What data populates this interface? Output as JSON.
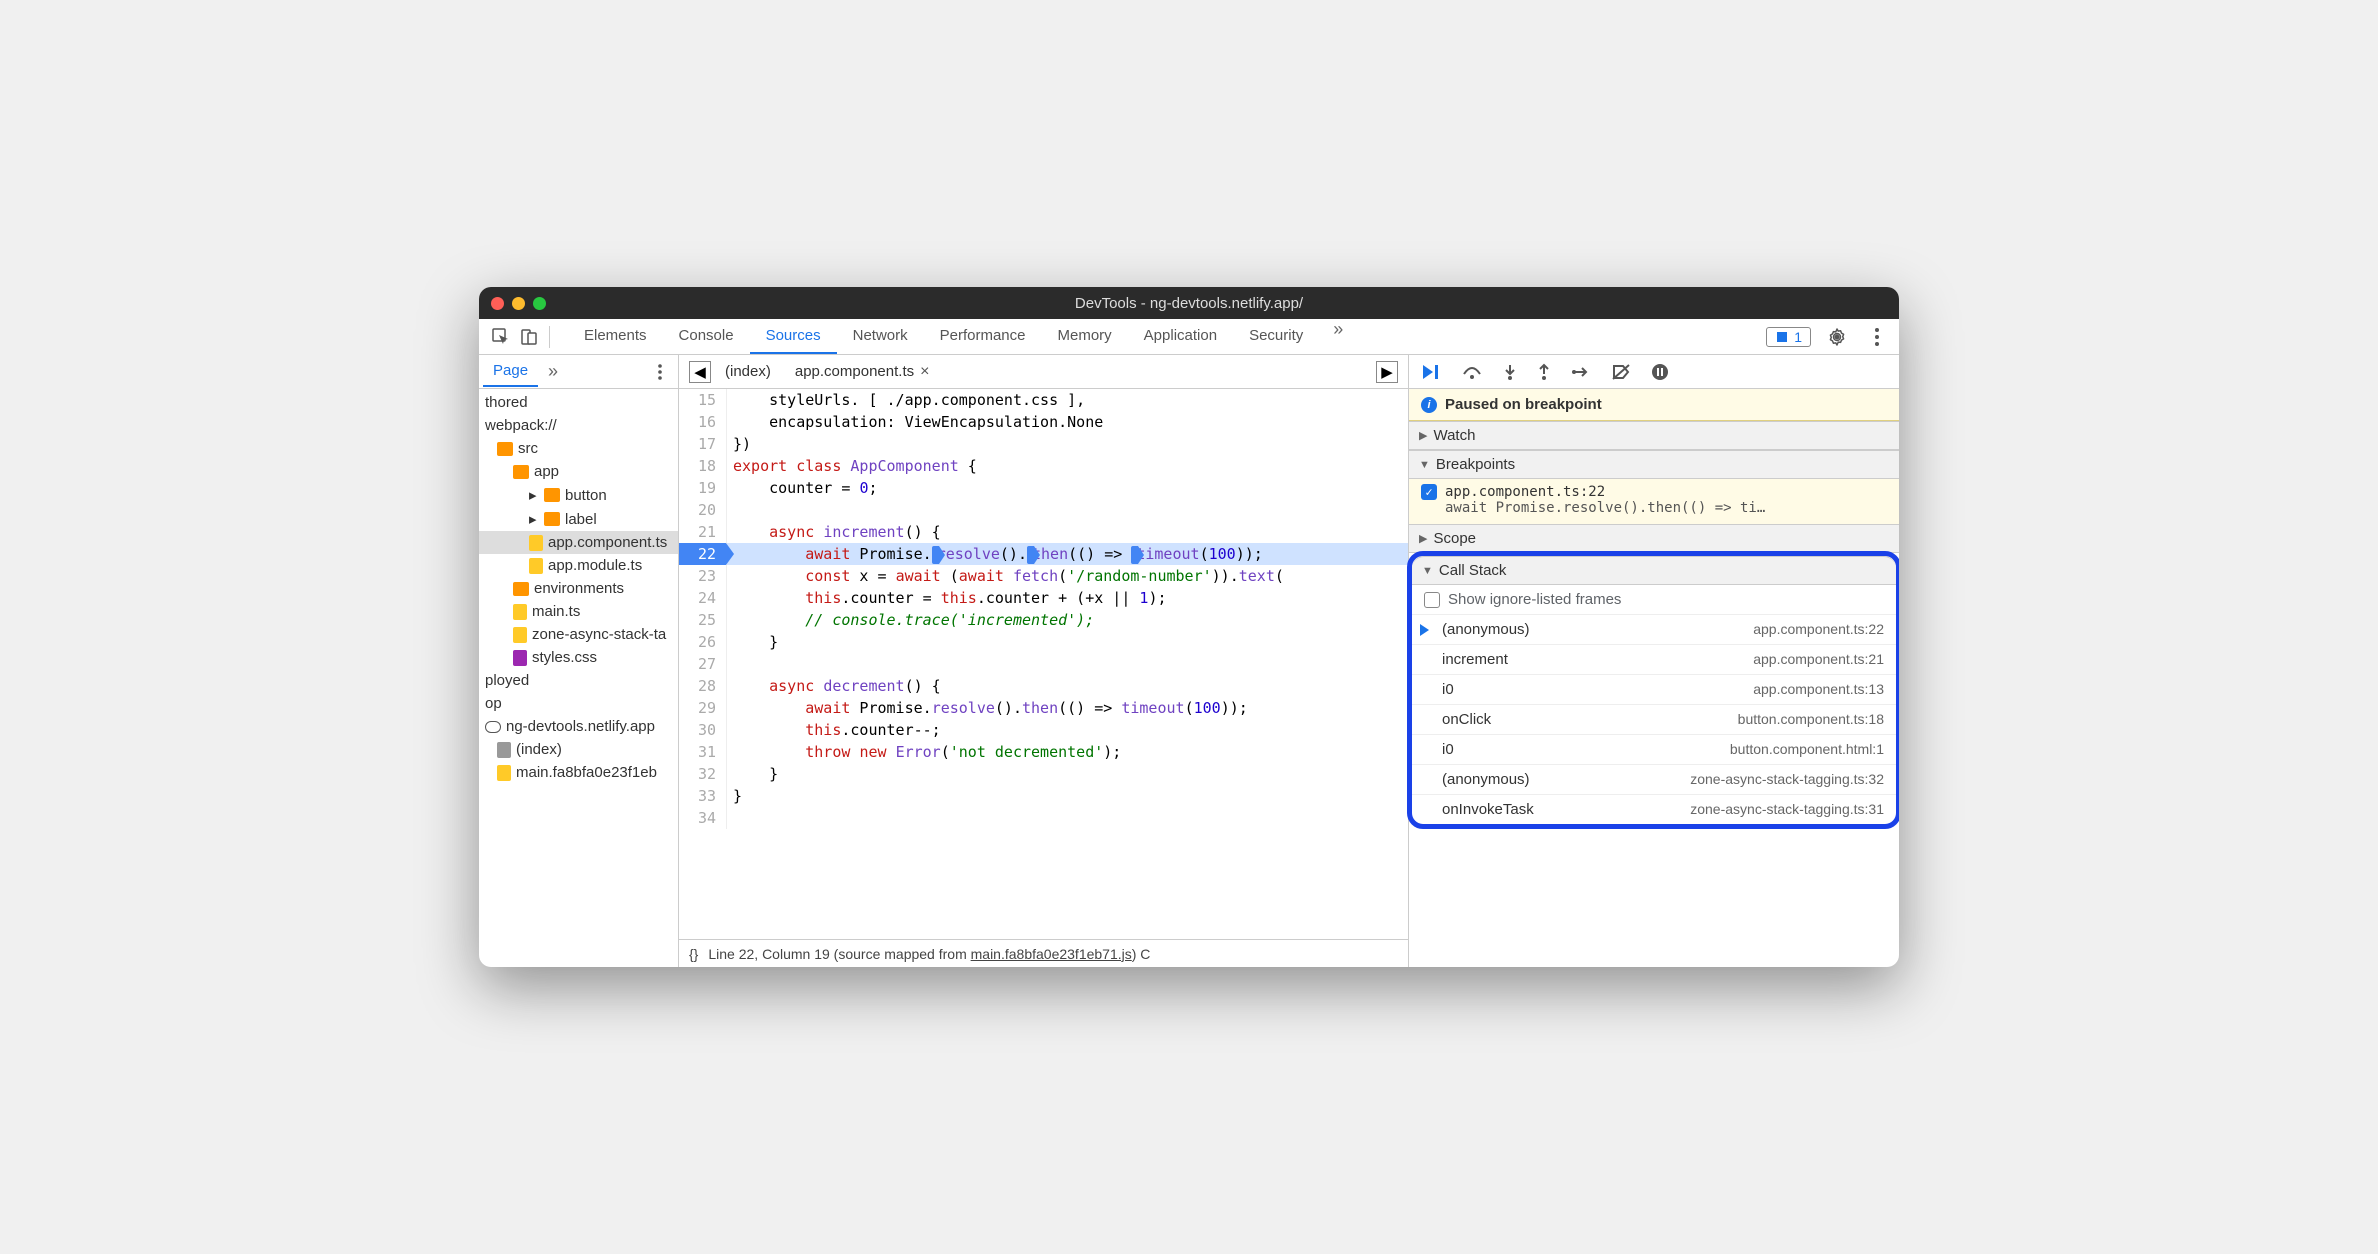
{
  "window": {
    "title": "DevTools - ng-devtools.netlify.app/"
  },
  "toolbar": {
    "tabs": [
      "Elements",
      "Console",
      "Sources",
      "Network",
      "Performance",
      "Memory",
      "Application",
      "Security"
    ],
    "active": "Sources",
    "issue_count": "1"
  },
  "nav": {
    "tab": "Page",
    "items": {
      "thored": "thored",
      "webpack": "webpack://",
      "src": "src",
      "app": "app",
      "button": "button",
      "label": "label",
      "appcomp": "app.component.ts",
      "appmod": "app.module.ts",
      "env": "environments",
      "main": "main.ts",
      "zone": "zone-async-stack-ta",
      "styles": "styles.css",
      "ployed": "ployed",
      "op": "op",
      "domain": "ng-devtools.netlify.app",
      "index": "(index)",
      "mainjs": "main.fa8bfa0e23f1eb"
    }
  },
  "editor": {
    "tabs": {
      "index": "(index)",
      "app": "app.component.ts"
    },
    "status": {
      "pos": "Line 22, Column 19",
      "mapped": "(source mapped from ",
      "mapfile": "main.fa8bfa0e23f1eb71.js",
      "end": ") C"
    }
  },
  "debug": {
    "paused": "Paused on breakpoint",
    "watch": "Watch",
    "breakpoints_hdr": "Breakpoints",
    "bp": {
      "loc": "app.component.ts:22",
      "code": "await Promise.resolve().then(() => ti…"
    },
    "scope": "Scope",
    "callstack_hdr": "Call Stack",
    "show_ignored": "Show ignore-listed frames",
    "frames": [
      {
        "name": "(anonymous)",
        "loc": "app.component.ts:22"
      },
      {
        "name": "increment",
        "loc": "app.component.ts:21"
      },
      {
        "name": "i0",
        "loc": "app.component.ts:13"
      },
      {
        "name": "onClick",
        "loc": "button.component.ts:18"
      },
      {
        "name": "i0",
        "loc": "button.component.html:1"
      },
      {
        "name": "(anonymous)",
        "loc": "zone-async-stack-tagging.ts:32"
      },
      {
        "name": "onInvokeTask",
        "loc": "zone-async-stack-tagging.ts:31"
      }
    ]
  }
}
